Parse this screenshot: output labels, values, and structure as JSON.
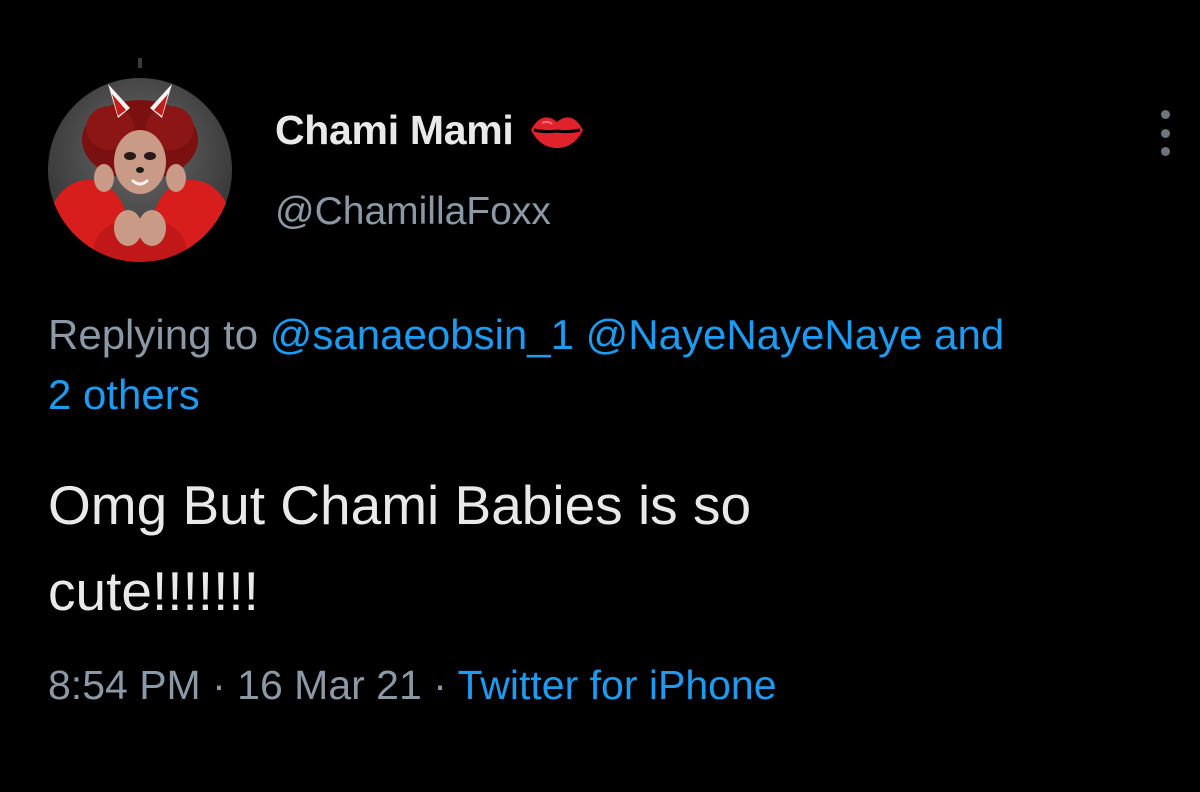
{
  "author": {
    "display_name": "Chami Mami",
    "handle": "@ChamillaFoxx",
    "name_emoji_icon": "kiss-mark-icon"
  },
  "reply": {
    "prefix": "Replying to",
    "mentions": [
      "@sanaeobsin_1",
      "@NayeNayeNaye"
    ],
    "connector": "and",
    "others": "2 others"
  },
  "tweet": {
    "text_line1": "Omg But Chami Babies is so",
    "text_line2": "cute!!!!!!!"
  },
  "meta": {
    "time": "8:54 PM",
    "separator": "·",
    "date": "16 Mar 21",
    "source": "Twitter for iPhone"
  },
  "colors": {
    "background": "#000000",
    "primary_text": "#e9e9e9",
    "secondary_text": "#8b98a5",
    "link": "#1d9bf0",
    "kiss_red": "#e0222a"
  }
}
